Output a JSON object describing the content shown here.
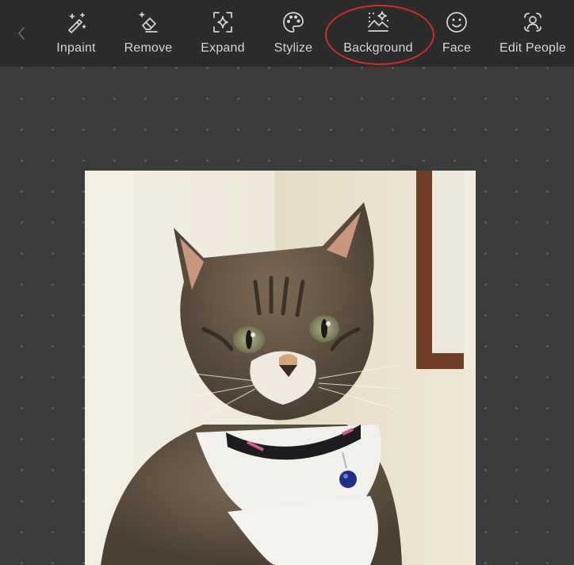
{
  "toolbar": {
    "back_icon": "chevron-left-icon",
    "tools": [
      {
        "label": "Inpaint",
        "icon": "magic-wand-icon"
      },
      {
        "label": "Remove",
        "icon": "eraser-icon"
      },
      {
        "label": "Expand",
        "icon": "expand-sparkle-icon"
      },
      {
        "label": "Stylize",
        "icon": "palette-icon"
      },
      {
        "label": "Background",
        "icon": "background-image-icon"
      },
      {
        "label": "Face",
        "icon": "smiley-face-icon"
      },
      {
        "label": "Edit People",
        "icon": "person-scan-icon"
      }
    ]
  },
  "colors": {
    "toolbar_bg": "#2b2b2b",
    "canvas_bg": "#3b3b3b",
    "text": "#d6d6d6",
    "highlight": "#d22a2a"
  }
}
